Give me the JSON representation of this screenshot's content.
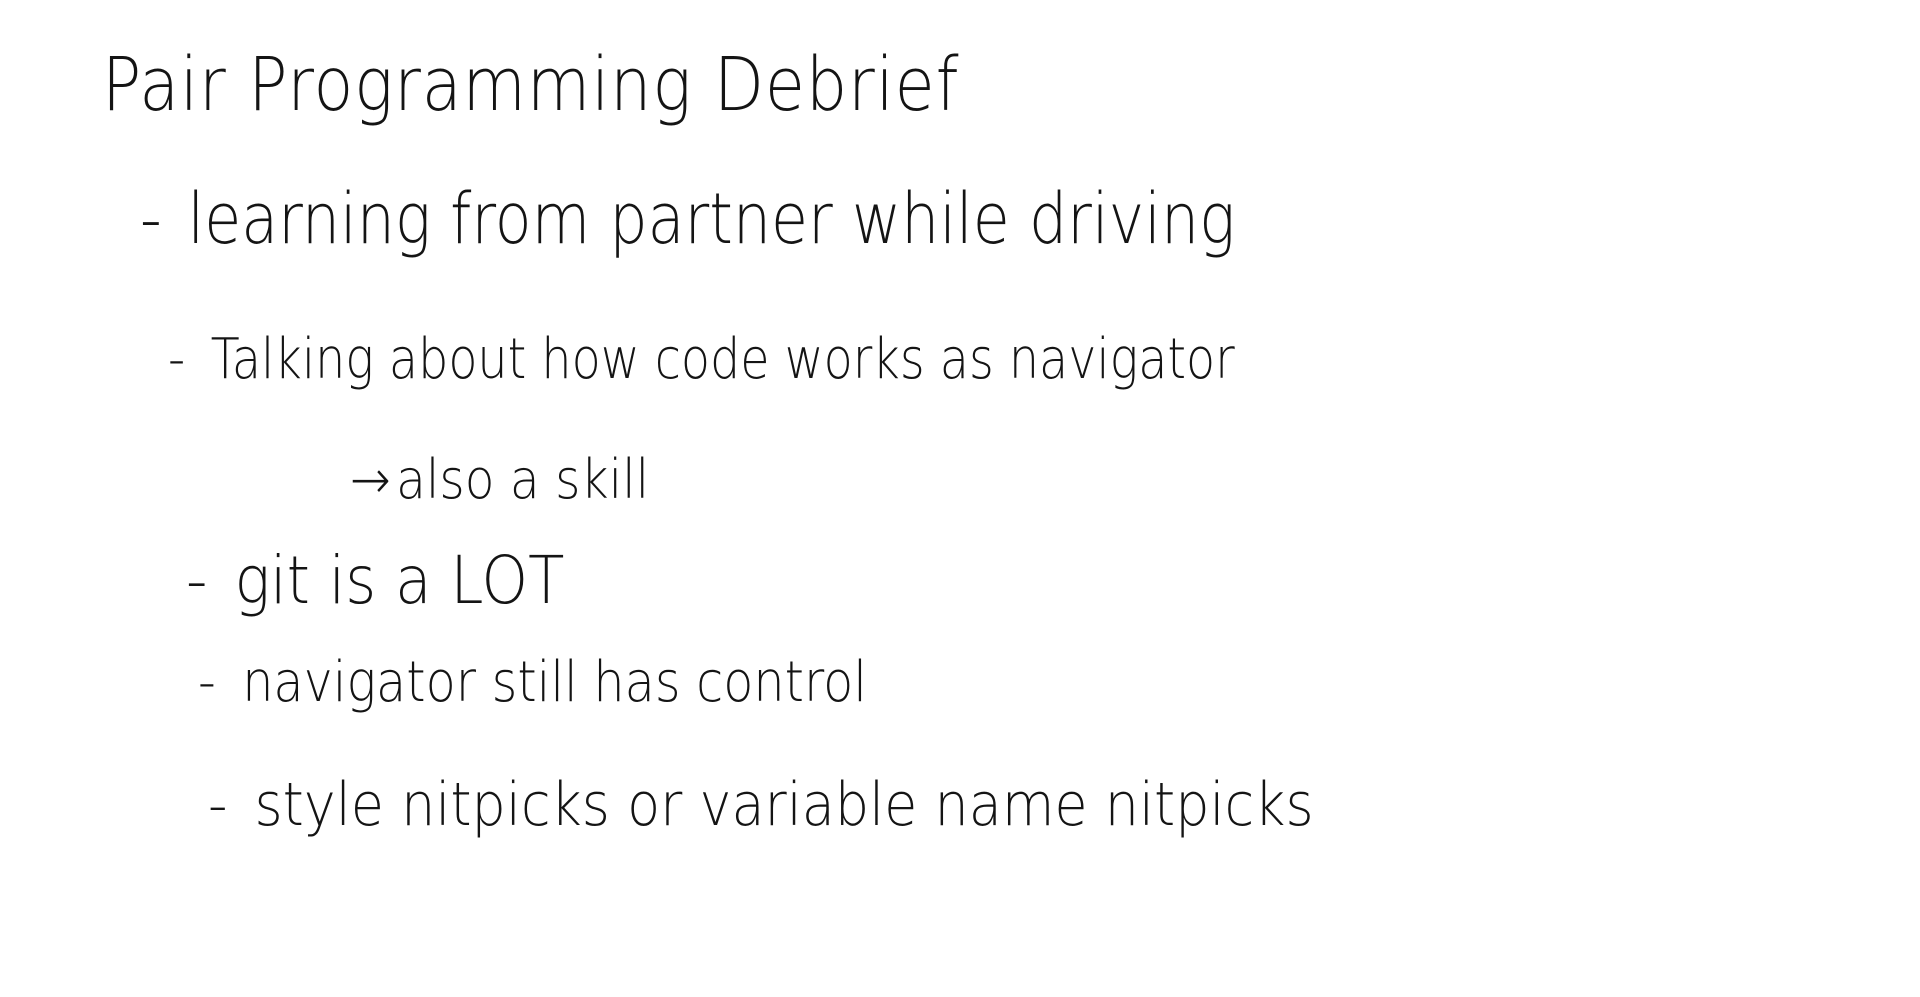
{
  "note": {
    "title": "Pair Programming Debrief",
    "bullet_marker": "-",
    "items": [
      {
        "text": "learning from partner while driving"
      },
      {
        "text": "Talking about how code works as navigator"
      },
      {
        "arrow": "→",
        "text": "also a skill"
      },
      {
        "text": "git is a LOT"
      },
      {
        "text": "navigator still has control"
      },
      {
        "text": "style nitpicks or variable name nitpicks"
      }
    ]
  },
  "colors": {
    "ink": "#141414",
    "background": "#ffffff"
  }
}
